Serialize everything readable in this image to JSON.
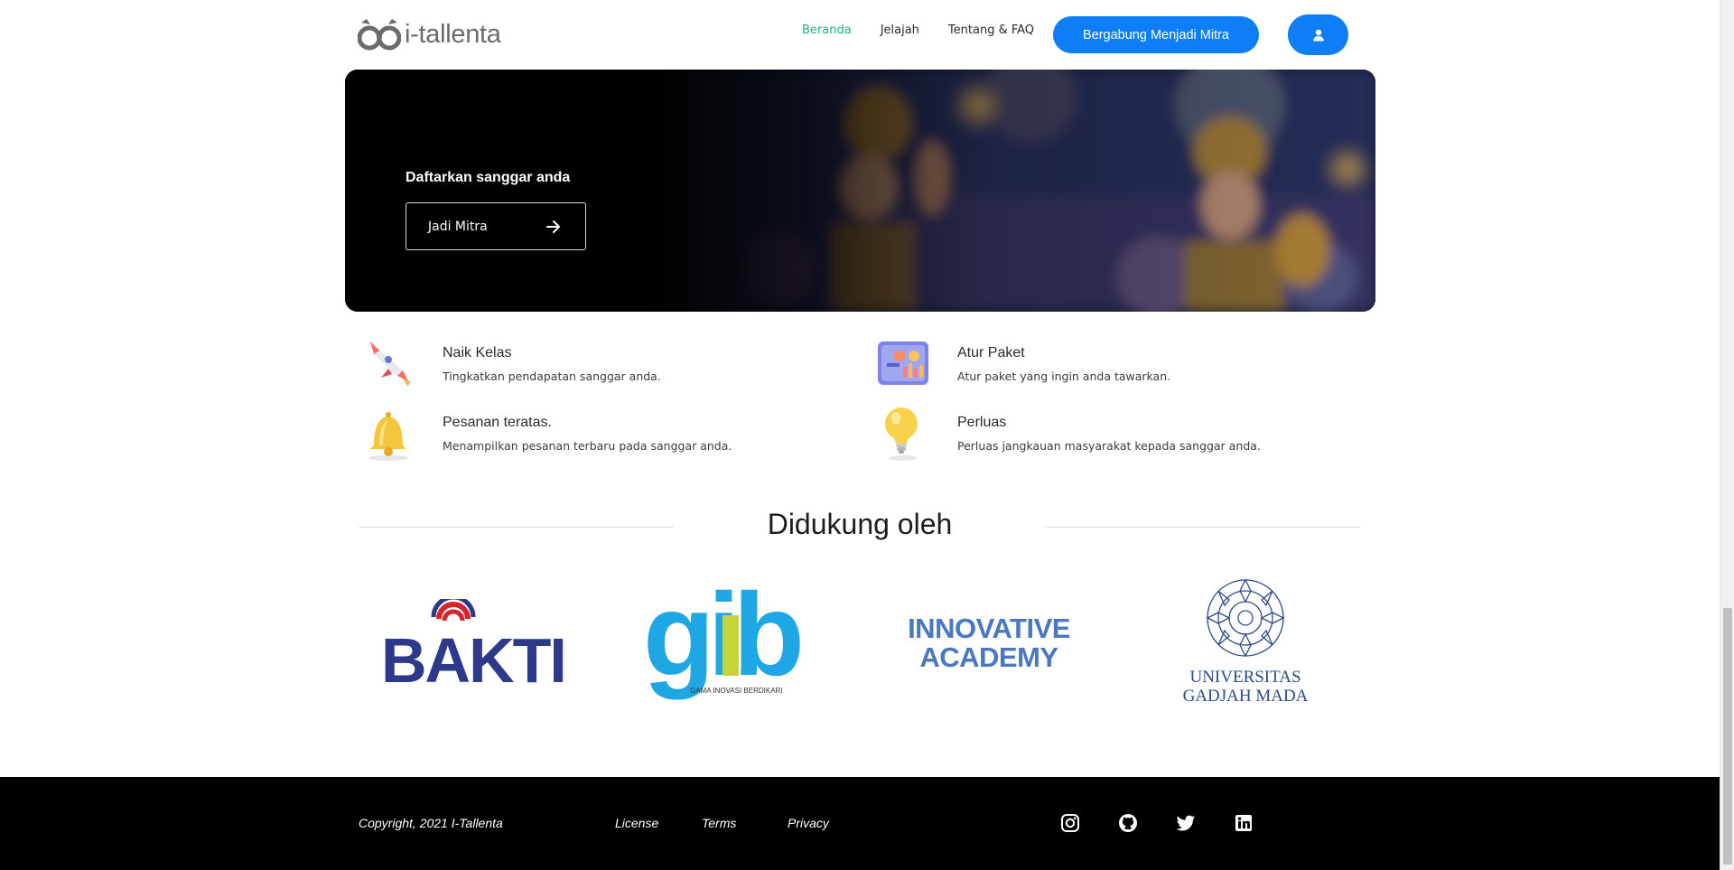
{
  "header": {
    "logo_text": "i-tallenta",
    "nav": [
      {
        "label": "Beranda",
        "active": true
      },
      {
        "label": "Jelajah",
        "active": false
      },
      {
        "label": "Tentang & FAQ",
        "active": false
      }
    ],
    "join_label": "Bergabung Menjadi Mitra",
    "user_icon": "user-icon"
  },
  "hero": {
    "title": "Daftarkan sanggar anda",
    "button_label": "Jadi Mitra",
    "button_icon": "arrow-right-icon"
  },
  "features": [
    {
      "icon": "rocket-icon",
      "title": "Naik Kelas",
      "desc": "Tingkatkan pendapatan sanggar anda."
    },
    {
      "icon": "dashboard-icon",
      "title": "Atur Paket",
      "desc": "Atur paket yang ingin anda tawarkan."
    },
    {
      "icon": "bell-icon",
      "title": "Pesanan teratas.",
      "desc": "Menampilkan pesanan terbaru pada sanggar anda."
    },
    {
      "icon": "lightbulb-icon",
      "title": "Perluas",
      "desc": "Perluas jangkauan masyarakat kepada sanggar anda."
    }
  ],
  "support": {
    "title": "Didukung oleh",
    "partners": [
      {
        "name": "BAKTI",
        "text": "BAKTI"
      },
      {
        "name": "GIB",
        "text": "gib",
        "subtext": "GAMA INOVASI BERDIKARI"
      },
      {
        "name": "Innovative Academy",
        "line1": "INNOVATIVE",
        "line2": "ACADEMY"
      },
      {
        "name": "Universitas Gadjah Mada",
        "line1": "UNIVERSITAS",
        "line2": "GADJAH MADA"
      }
    ]
  },
  "footer": {
    "copyright": "Copyright, 2021 I-Tallenta",
    "links": [
      "License",
      "Terms",
      "Privacy"
    ],
    "social": [
      "instagram-icon",
      "github-icon",
      "twitter-icon",
      "linkedin-icon"
    ]
  },
  "colors": {
    "primary": "#0d7ef5",
    "nav_active": "#1bb37a",
    "footer_bg": "#000000"
  }
}
